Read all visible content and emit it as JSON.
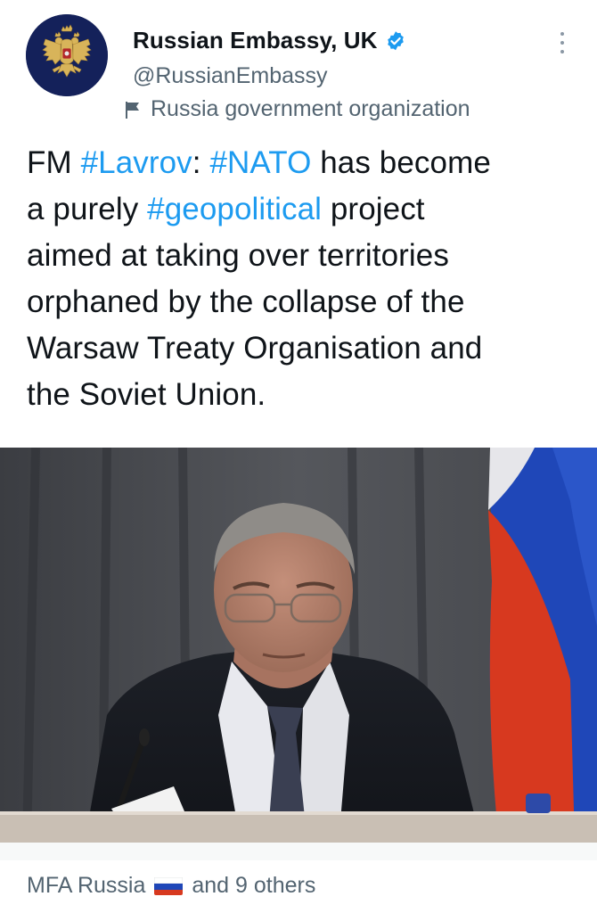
{
  "account": {
    "display_name": "Russian Embassy, UK",
    "handle": "@RussianEmbassy",
    "label": "Russia government organization",
    "verified": true,
    "avatar": "coat-of-arms-icon"
  },
  "tweet": {
    "lines": [
      [
        {
          "t": "FM "
        },
        {
          "t": "#Lavrov",
          "tag": true
        },
        {
          "t": ": "
        },
        {
          "t": "#NATO",
          "tag": true
        },
        {
          "t": " has become"
        }
      ],
      [
        {
          "t": "a purely "
        },
        {
          "t": "#geopolitical",
          "tag": true
        },
        {
          "t": " project"
        }
      ],
      [
        {
          "t": "aimed at taking over territories"
        }
      ],
      [
        {
          "t": "orphaned by the collapse of the"
        }
      ],
      [
        {
          "t": "Warsaw Treaty Organisation and"
        }
      ],
      [
        {
          "t": "the Soviet Union."
        }
      ]
    ]
  },
  "media": {
    "icon": "photo-icon",
    "flag_colors": [
      "#ffffff",
      "#1f47b8",
      "#d7391f"
    ],
    "background_color": "#4d4f54"
  },
  "footer": {
    "liker": "MFA Russia",
    "liker_flag": "russia-flag-icon",
    "others": "and 9 others"
  },
  "colors": {
    "hashtag": "#1d9bf0",
    "secondary_text": "#536471",
    "verified_badge": "#1d9bf0"
  }
}
